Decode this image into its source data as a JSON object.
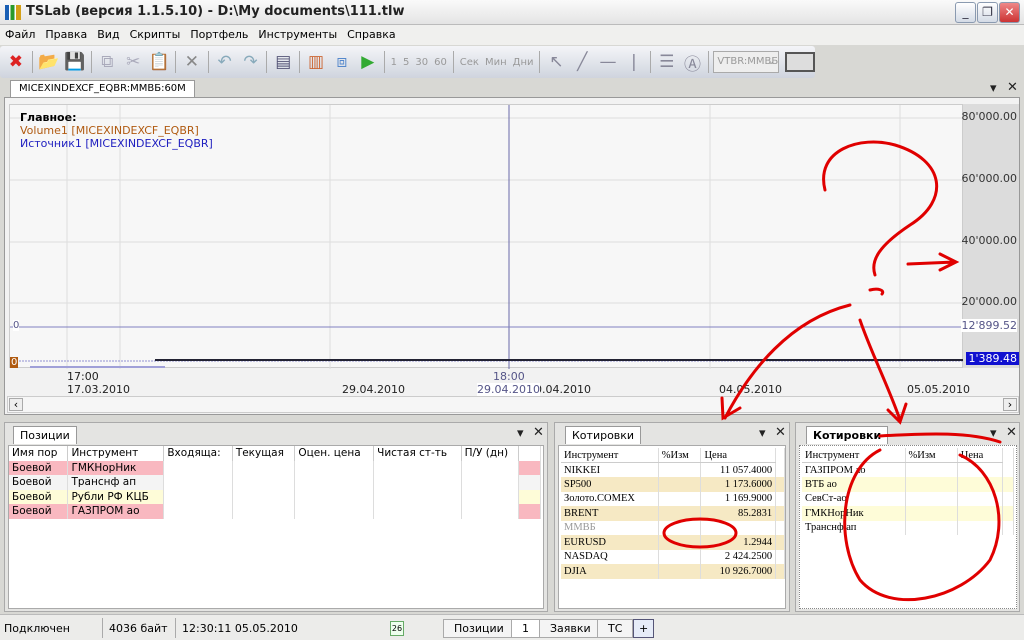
{
  "window": {
    "title": "TSLab (версия 1.1.5.10) - D:\\My documents\\111.tlw"
  },
  "menu": [
    "Файл",
    "Правка",
    "Вид",
    "Скрипты",
    "Портфель",
    "Инструменты",
    "Справка"
  ],
  "toolbar": {
    "intervals": [
      "1",
      "5",
      "30",
      "60"
    ],
    "units": [
      "Сек",
      "Мин",
      "Дни"
    ],
    "instrument_combo": "VTBR:ММВБ"
  },
  "chart": {
    "tab": "MICEXINDEXCF_EQBR:ММВБ:60M",
    "legend_title": "Главное:",
    "legend": [
      {
        "label": "Volume1 [MICEXINDEXCF_EQBR]",
        "color": "#b05a10"
      },
      {
        "label": "Источник1 [MICEXINDEXCF_EQBR]",
        "color": "#2020c0"
      }
    ],
    "y_ticks": [
      "80'000.00",
      "60'000.00",
      "40'000.00",
      "20'000.00"
    ],
    "level_line": "12'899.52",
    "level_left": "0",
    "last_price": "1'389.48",
    "last_left": "0",
    "x_time": "17:00",
    "x_dates": [
      "17.03.2010",
      "29.04.2010",
      "0.04.2010",
      "04.05.2010",
      "05.05.2010"
    ],
    "crosshair_time": "18:00",
    "crosshair_date": "29.04.2010"
  },
  "positions": {
    "tab": "Позиции",
    "columns": [
      "Имя пор",
      "Инструмент",
      "Входяща:",
      "Текущая",
      "Оцен. цена",
      "Чистая ст-ть",
      "П/У (дн)"
    ],
    "rows": [
      {
        "name": "Боевой",
        "instrument": "ГМКНорНик",
        "style": "pink"
      },
      {
        "name": "Боевой",
        "instrument": "Транснф ап",
        "style": "grey"
      },
      {
        "name": "Боевой",
        "instrument": "Рубли РФ КЦБ",
        "style": "yel"
      },
      {
        "name": "Боевой",
        "instrument": "ГАЗПРОМ ао",
        "style": "pink"
      }
    ]
  },
  "quotes1": {
    "tab": "Котировки",
    "columns": [
      "Инструмент",
      "%Изм",
      "Цена"
    ],
    "rows": [
      [
        "NIKKEI",
        "",
        "11 057.4000"
      ],
      [
        "SP500",
        "",
        "1 173.6000"
      ],
      [
        "Золото.COMEX",
        "",
        "1 169.9000"
      ],
      [
        "BRENT",
        "",
        "85.2831"
      ],
      [
        "ММВБ",
        "",
        ""
      ],
      [
        "EURUSD",
        "",
        "1.2944"
      ],
      [
        "NASDAQ",
        "",
        "2 424.2500"
      ],
      [
        "DJIA",
        "",
        "10 926.7000"
      ]
    ]
  },
  "quotes2": {
    "tab": "Котировки",
    "columns": [
      "Инструмент",
      "%Изм",
      "Цена"
    ],
    "rows": [
      "ГАЗПРОМ ао",
      "ВТБ ао",
      "СевСт-ао",
      "ГМКНорНик",
      "Транснф ап"
    ]
  },
  "status": {
    "state": "Подключен",
    "bytes": "4036 байт",
    "datetime": "12:30:11 05.05.2010",
    "calendar": "26",
    "tabs": [
      "Позиции",
      "1",
      "Заявки",
      "ТС",
      "+"
    ]
  },
  "annotation": {
    "color": "#e00000"
  }
}
